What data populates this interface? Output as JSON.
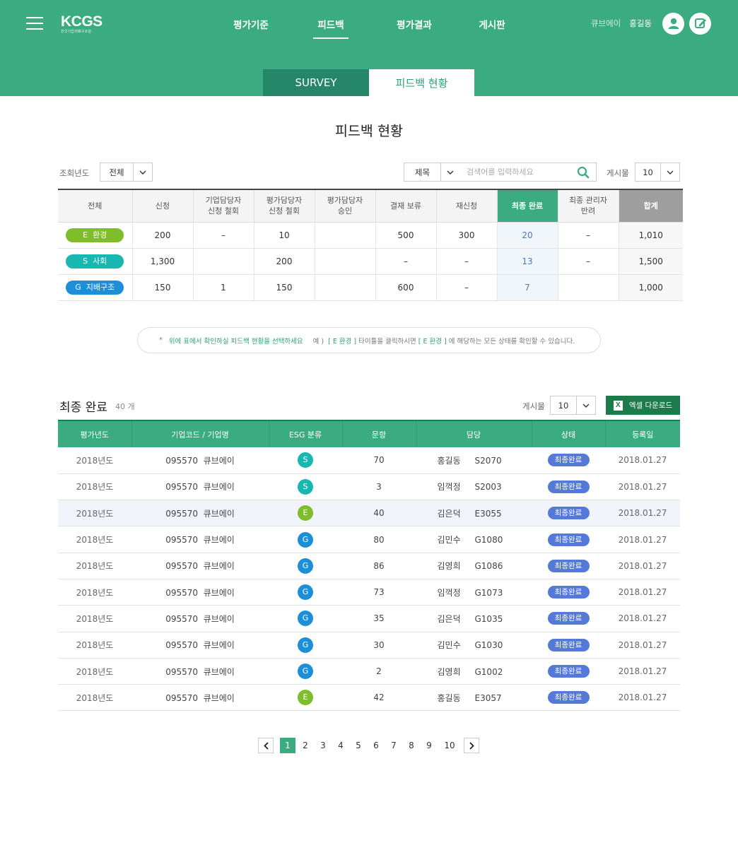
{
  "header": {
    "logo_text": "KCGS",
    "logo_sub": "한국기업지배구조원",
    "nav": [
      {
        "label": "평가기준"
      },
      {
        "label": "피드백"
      },
      {
        "label": "평가결과"
      },
      {
        "label": "게시판"
      }
    ],
    "active_nav": "피드백",
    "user_company": "큐브에이",
    "user_name": "홍길동"
  },
  "tabs": [
    {
      "label": "SURVEY"
    },
    {
      "label": "피드백 현황"
    }
  ],
  "page_title": "피드백 현황",
  "filters": {
    "year_label": "조회년도",
    "year_value": "전체",
    "search_type": "제목",
    "search_placeholder": "검색어를 입력하세요",
    "per_page_label": "게시물",
    "per_page_value": "10"
  },
  "status_table": {
    "headers": [
      "전체",
      "신청",
      "기업담당자\n신청 철회",
      "평가담당자\n신청 철회",
      "평가담당자\n승인",
      "결재 보류",
      "재신청",
      "최종 완료",
      "최종 관리자\n반려",
      "합계"
    ],
    "rows": [
      {
        "category": "E  환경",
        "cells": [
          "200",
          "–",
          "10",
          "",
          "500",
          "300",
          "20",
          "–",
          "1,010"
        ]
      },
      {
        "category": "S  사회",
        "cells": [
          "1,300",
          "",
          "200",
          "",
          "–",
          "–",
          "13",
          "–",
          "1,500"
        ]
      },
      {
        "category": "G  지배구조",
        "cells": [
          "150",
          "1",
          "150",
          "",
          "600",
          "–",
          "7",
          "",
          "1,000"
        ]
      }
    ]
  },
  "hint": {
    "star": "*",
    "main": "위에 표에서 확인하실 피드백 현황을 선택하세요",
    "ex_prefix": "예 )",
    "ex_tag1": "[ E 환경 ]",
    "ex_mid": "타이틀을 클릭하시면",
    "ex_tag2": "[ E 환경 ]",
    "ex_suffix": "에 해당하는 모든 상태를 확인할 수 있습니다."
  },
  "final_section": {
    "title": "최종 완료",
    "count": "40 개",
    "per_page_label": "게시물",
    "per_page_value": "10",
    "excel_icon": "X",
    "excel_label": "엑셀 다운로드",
    "headers": [
      "평가년도",
      "기업코드 / 기업명",
      "ESG 분류",
      "문항",
      "담당",
      "상태",
      "등록일"
    ],
    "rows": [
      {
        "year": "2018년도",
        "company": "095570  큐브에이",
        "esg": "S",
        "question": "70",
        "manager": "홍길동",
        "code": "S2070",
        "status": "최종완료",
        "date": "2018.01.27"
      },
      {
        "year": "2018년도",
        "company": "095570  큐브에이",
        "esg": "S",
        "question": "3",
        "manager": "임꺽정",
        "code": "S2003",
        "status": "최종완료",
        "date": "2018.01.27"
      },
      {
        "year": "2018년도",
        "company": "095570  큐브에이",
        "esg": "E",
        "question": "40",
        "manager": "김은덕",
        "code": "E3055",
        "status": "최종완료",
        "date": "2018.01.27"
      },
      {
        "year": "2018년도",
        "company": "095570  큐브에이",
        "esg": "G",
        "question": "80",
        "manager": "김민수",
        "code": "G1080",
        "status": "최종완료",
        "date": "2018.01.27"
      },
      {
        "year": "2018년도",
        "company": "095570  큐브에이",
        "esg": "G",
        "question": "86",
        "manager": "김영희",
        "code": "G1086",
        "status": "최종완료",
        "date": "2018.01.27"
      },
      {
        "year": "2018년도",
        "company": "095570  큐브에이",
        "esg": "G",
        "question": "73",
        "manager": "임꺽정",
        "code": "G1073",
        "status": "최종완료",
        "date": "2018.01.27"
      },
      {
        "year": "2018년도",
        "company": "095570  큐브에이",
        "esg": "G",
        "question": "35",
        "manager": "김은덕",
        "code": "G1035",
        "status": "최종완료",
        "date": "2018.01.27"
      },
      {
        "year": "2018년도",
        "company": "095570  큐브에이",
        "esg": "G",
        "question": "30",
        "manager": "김민수",
        "code": "G1030",
        "status": "최종완료",
        "date": "2018.01.27"
      },
      {
        "year": "2018년도",
        "company": "095570  큐브에이",
        "esg": "G",
        "question": "2",
        "manager": "김영희",
        "code": "G1002",
        "status": "최종완료",
        "date": "2018.01.27"
      },
      {
        "year": "2018년도",
        "company": "095570  큐브에이",
        "esg": "E",
        "question": "42",
        "manager": "홍길동",
        "code": "E3057",
        "status": "최종완료",
        "date": "2018.01.27"
      }
    ]
  },
  "pagination": {
    "pages": [
      "1",
      "2",
      "3",
      "4",
      "5",
      "6",
      "7",
      "8",
      "9",
      "10"
    ],
    "current": "1"
  },
  "colors": {
    "brand_green": "#3bac82",
    "dark_green": "#25866a",
    "excel_green": "#1d7a4a",
    "esg_e": "#7fbd2b",
    "esg_s": "#18b8b0",
    "esg_g": "#1c8fd8",
    "status_blue": "#5479d8"
  }
}
